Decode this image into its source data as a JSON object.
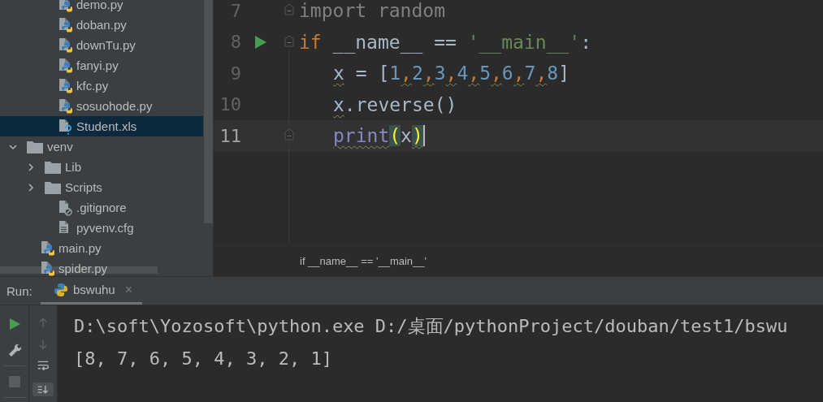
{
  "project_tree": {
    "items": [
      {
        "children": [
          {
            "label": "demo.py",
            "kind": "python",
            "selected": false
          },
          {
            "label": "doban.py",
            "kind": "python",
            "selected": false
          },
          {
            "label": "downTu.py",
            "kind": "python",
            "selected": false
          },
          {
            "label": "fanyi.py",
            "kind": "python",
            "selected": false
          },
          {
            "label": "kfc.py",
            "kind": "python",
            "selected": false
          },
          {
            "label": "sosuohode.py",
            "kind": "python",
            "selected": false
          },
          {
            "label": "Student.xls",
            "kind": "unknown",
            "selected": true
          }
        ]
      },
      {
        "label": "venv",
        "kind": "folder",
        "expanded": true,
        "selected": false,
        "children": [
          {
            "label": "Lib",
            "kind": "folder",
            "expanded": false,
            "selected": false
          },
          {
            "label": "Scripts",
            "kind": "folder",
            "expanded": false,
            "selected": false
          },
          {
            "label": ".gitignore",
            "kind": "ignored",
            "selected": false
          },
          {
            "label": "pyvenv.cfg",
            "kind": "text",
            "selected": false
          }
        ]
      },
      {
        "label": "main.py",
        "kind": "python",
        "selected": false
      },
      {
        "label": "spider.py",
        "kind": "python",
        "selected": false
      }
    ]
  },
  "editor": {
    "lines": [
      {
        "number": "7",
        "fold_start": true,
        "fold_end": false,
        "run": false,
        "current": false,
        "indent": false,
        "tokens": [
          {
            "text": "import random",
            "kind": "unused"
          }
        ]
      },
      {
        "number": "8",
        "fold_start": true,
        "fold_end": false,
        "run": true,
        "current": false,
        "indent": false,
        "tokens": [
          {
            "text": "if",
            "kind": "keyword"
          },
          {
            "text": " __name__ == ",
            "kind": "plain"
          },
          {
            "text": "'__main__'",
            "kind": "string"
          },
          {
            "text": ":",
            "kind": "plain"
          }
        ]
      },
      {
        "number": "9",
        "fold_start": false,
        "fold_end": false,
        "run": false,
        "current": false,
        "indent": true,
        "tokens": [
          {
            "text": "x",
            "kind": "plain",
            "warning": true
          },
          {
            "text": " = [",
            "kind": "plain"
          },
          {
            "text": "1",
            "kind": "number"
          },
          {
            "text": ",",
            "kind": "comma",
            "warning": true
          },
          {
            "text": "2",
            "kind": "number"
          },
          {
            "text": ",",
            "kind": "comma",
            "warning": true
          },
          {
            "text": "3",
            "kind": "number"
          },
          {
            "text": ",",
            "kind": "comma",
            "warning": true
          },
          {
            "text": "4",
            "kind": "number"
          },
          {
            "text": ",",
            "kind": "comma",
            "warning": true
          },
          {
            "text": "5",
            "kind": "number"
          },
          {
            "text": ",",
            "kind": "comma",
            "warning": true
          },
          {
            "text": "6",
            "kind": "number"
          },
          {
            "text": ",",
            "kind": "comma",
            "warning": true
          },
          {
            "text": "7",
            "kind": "number"
          },
          {
            "text": ",",
            "kind": "comma",
            "warning": true
          },
          {
            "text": "8",
            "kind": "number"
          },
          {
            "text": "]",
            "kind": "plain"
          }
        ]
      },
      {
        "number": "10",
        "fold_start": false,
        "fold_end": false,
        "run": false,
        "current": false,
        "indent": true,
        "tokens": [
          {
            "text": "x",
            "kind": "plain",
            "warning": true
          },
          {
            "text": ".reverse()",
            "kind": "plain"
          }
        ]
      },
      {
        "number": "11",
        "fold_start": false,
        "fold_end": true,
        "run": false,
        "current": true,
        "indent": true,
        "tokens": [
          {
            "text": "print",
            "kind": "builtin",
            "warning": true
          },
          {
            "text": "(",
            "kind": "brace"
          },
          {
            "text": "x",
            "kind": "plain"
          },
          {
            "text": ")",
            "kind": "brace",
            "warning": true
          }
        ]
      }
    ],
    "breadcrumb": "if __name__ == '__main__'"
  },
  "run_panel": {
    "label": "Run:",
    "tab": {
      "title": "bswuhu",
      "close": "×",
      "selected": true
    },
    "scroll_to_end_on": true,
    "console": [
      "D:\\soft\\Yozosoft\\python.exe D:/桌面/pythonProject/douban/test1/bswu",
      "[8, 7, 6, 5, 4, 3, 2, 1]"
    ]
  }
}
